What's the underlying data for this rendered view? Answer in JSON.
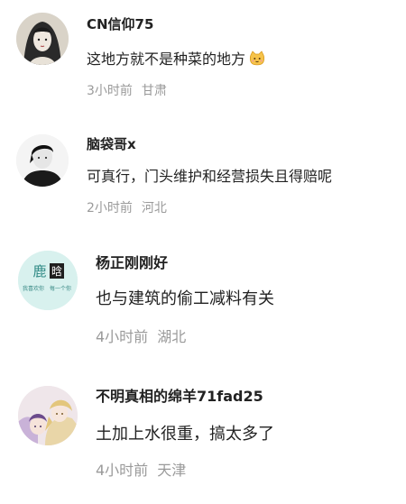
{
  "comments": [
    {
      "username": "CN信仰75",
      "text": "这地方就不是种菜的地方",
      "emoji": "cat-face-icon",
      "time": "3小时前",
      "location": "甘肃",
      "avatar": "avatar-ink-woman"
    },
    {
      "username": "脑袋哥x",
      "text": "可真行，门头维护和经营损失且得赔呢",
      "time": "2小时前",
      "location": "河北",
      "avatar": "avatar-man-black-white"
    },
    {
      "username": "杨正刚刚好",
      "text": "也与建筑的偷工减料有关",
      "time": "4小时前",
      "location": "湖北",
      "avatar": "avatar-text",
      "avatar_text": {
        "top": "鹿",
        "badge": "晗",
        "left_small": "我喜欢你",
        "right_small": "每一个你"
      }
    },
    {
      "username": "不明真相的绵羊71fad25",
      "text": "土加上水很重，搞太多了",
      "time": "4小时前",
      "location": "天津",
      "avatar": "avatar-anime-couple"
    }
  ]
}
